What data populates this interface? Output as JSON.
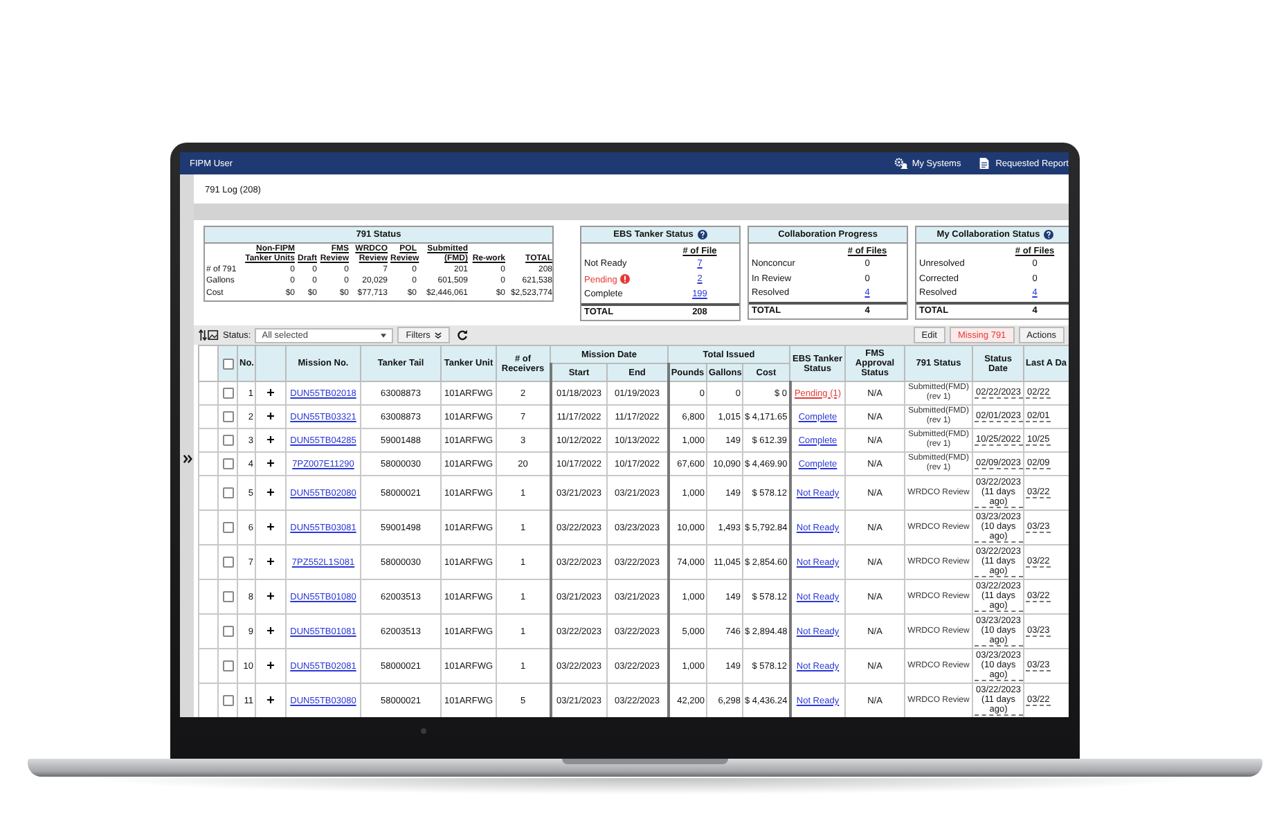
{
  "window": {
    "user": "FIPM User",
    "nav": [
      {
        "label": "My Systems",
        "kind": "systems"
      },
      {
        "label": "Requested Report",
        "kind": "report"
      }
    ]
  },
  "log_title": "791 Log (208)",
  "status_791": {
    "title": "791 Status",
    "columns": [
      "Non-FIPM Tanker Units",
      "Draft",
      "FMS Review",
      "WRDCO Review",
      "POL Review",
      "Submitted (FMD)",
      "Re-work",
      "TOTAL"
    ],
    "rows": [
      {
        "label": "# of 791",
        "values": [
          "0",
          "0",
          "0",
          "7",
          "0",
          "201",
          "0",
          "208"
        ]
      },
      {
        "label": "Gallons",
        "values": [
          "0",
          "0",
          "0",
          "20,029",
          "0",
          "601,509",
          "0",
          "621,538"
        ]
      },
      {
        "label": "Cost",
        "values": [
          "$0",
          "$0",
          "$0",
          "$77,713",
          "$0",
          "$2,446,061",
          "$0",
          "$2,523,774"
        ]
      }
    ]
  },
  "summaries": [
    {
      "title": "EBS Tanker Status",
      "help": true,
      "column": "# of File",
      "rows": [
        {
          "label": "Not Ready",
          "value": "7",
          "alert": false,
          "link": true
        },
        {
          "label": "Pending",
          "value": "2",
          "alert": true,
          "link": true
        },
        {
          "label": "Complete",
          "value": "199",
          "alert": false,
          "link": true
        }
      ],
      "total": {
        "label": "TOTAL",
        "value": "208"
      }
    },
    {
      "title": "Collaboration Progress",
      "help": false,
      "column": "# of Files",
      "rows": [
        {
          "label": "Nonconcur",
          "value": "0",
          "alert": false,
          "link": false
        },
        {
          "label": "In Review",
          "value": "0",
          "alert": false,
          "link": false
        },
        {
          "label": "Resolved",
          "value": "4",
          "alert": false,
          "link": true
        }
      ],
      "total": {
        "label": "TOTAL",
        "value": "4"
      }
    },
    {
      "title": "My Collaboration Status",
      "help": true,
      "column": "# of Files",
      "rows": [
        {
          "label": "Unresolved",
          "value": "0",
          "alert": false,
          "link": false
        },
        {
          "label": "Corrected",
          "value": "0",
          "alert": false,
          "link": false
        },
        {
          "label": "Resolved",
          "value": "4",
          "alert": false,
          "link": true
        }
      ],
      "total": {
        "label": "TOTAL",
        "value": "4"
      }
    }
  ],
  "toolbar": {
    "status_label": "Status:",
    "status_value": "All selected",
    "filters": "Filters",
    "buttons": [
      {
        "label": "Edit",
        "kind": "normal"
      },
      {
        "label": "Missing 791",
        "kind": "warning"
      },
      {
        "label": "Actions",
        "kind": "normal"
      }
    ]
  },
  "table": {
    "header_checked": false,
    "number_label": "No.",
    "columns": [
      {
        "label": "Mission No."
      },
      {
        "label": "Tanker Tail"
      },
      {
        "label": "Tanker Unit"
      },
      {
        "label": "# of Receivers"
      },
      {
        "label": "Mission Date",
        "children": [
          {
            "label": "Start"
          },
          {
            "label": "End"
          }
        ]
      },
      {
        "label": "Total Issued",
        "children": [
          {
            "label": "Pounds"
          },
          {
            "label": "Gallons"
          },
          {
            "label": "Cost"
          }
        ]
      },
      {
        "label": "EBS Tanker Status"
      },
      {
        "label": "FMS Approval Status"
      },
      {
        "label": "791 Status"
      },
      {
        "label": "Status Date"
      },
      {
        "label": "Last A Da"
      }
    ],
    "rows": [
      {
        "checked": false,
        "no": "1",
        "mission": "DUN55TB02018",
        "tail": "63008873",
        "unit": "101ARFWG",
        "receivers": "2",
        "start": "01/18/2023",
        "end": "01/19/2023",
        "pounds": "0",
        "gallons": "0",
        "cost": "$ 0",
        "ebs": {
          "text": "Pending (1)",
          "kind": "pending"
        },
        "fms": "N/A",
        "status": "Submitted(FMD) (rev 1)",
        "status_date": "02/22/2023",
        "last": "02/22"
      },
      {
        "checked": false,
        "no": "2",
        "mission": "DUN55TB03321",
        "tail": "63008873",
        "unit": "101ARFWG",
        "receivers": "7",
        "start": "11/17/2022",
        "end": "11/17/2022",
        "pounds": "6,800",
        "gallons": "1,015",
        "cost": "$ 4,171.65",
        "ebs": {
          "text": "Complete",
          "kind": "link"
        },
        "fms": "N/A",
        "status": "Submitted(FMD) (rev 1)",
        "status_date": "02/01/2023",
        "last": "02/01"
      },
      {
        "checked": false,
        "no": "3",
        "mission": "DUN55TB04285",
        "tail": "59001488",
        "unit": "101ARFWG",
        "receivers": "3",
        "start": "10/12/2022",
        "end": "10/13/2022",
        "pounds": "1,000",
        "gallons": "149",
        "cost": "$ 612.39",
        "ebs": {
          "text": "Complete",
          "kind": "link"
        },
        "fms": "N/A",
        "status": "Submitted(FMD) (rev 1)",
        "status_date": "10/25/2022",
        "last": "10/25"
      },
      {
        "checked": false,
        "no": "4",
        "mission": "7PZ007E11290",
        "tail": "58000030",
        "unit": "101ARFWG",
        "receivers": "20",
        "start": "10/17/2022",
        "end": "10/17/2022",
        "pounds": "67,600",
        "gallons": "10,090",
        "cost": "$ 4,469.90",
        "ebs": {
          "text": "Complete",
          "kind": "link"
        },
        "fms": "N/A",
        "status": "Submitted(FMD) (rev 1)",
        "status_date": "02/09/2023",
        "last": "02/09"
      },
      {
        "checked": false,
        "no": "5",
        "mission": "DUN55TB02080",
        "tail": "58000021",
        "unit": "101ARFWG",
        "receivers": "1",
        "start": "03/21/2023",
        "end": "03/21/2023",
        "pounds": "1,000",
        "gallons": "149",
        "cost": "$ 578.12",
        "ebs": {
          "text": "Not Ready",
          "kind": "link"
        },
        "fms": "N/A",
        "status": "WRDCO Review",
        "status_date": "03/22/2023 (11 days ago)",
        "last": "03/22"
      },
      {
        "checked": false,
        "no": "6",
        "mission": "DUN55TB03081",
        "tail": "59001498",
        "unit": "101ARFWG",
        "receivers": "1",
        "start": "03/22/2023",
        "end": "03/23/2023",
        "pounds": "10,000",
        "gallons": "1,493",
        "cost": "$ 5,792.84",
        "ebs": {
          "text": "Not Ready",
          "kind": "link"
        },
        "fms": "N/A",
        "status": "WRDCO Review",
        "status_date": "03/23/2023 (10 days ago)",
        "last": "03/23"
      },
      {
        "checked": false,
        "no": "7",
        "mission": "7PZ552L1S081",
        "tail": "58000030",
        "unit": "101ARFWG",
        "receivers": "1",
        "start": "03/22/2023",
        "end": "03/22/2023",
        "pounds": "74,000",
        "gallons": "11,045",
        "cost": "$ 2,854.60",
        "ebs": {
          "text": "Not Ready",
          "kind": "link"
        },
        "fms": "N/A",
        "status": "WRDCO Review",
        "status_date": "03/22/2023 (11 days ago)",
        "last": "03/22"
      },
      {
        "checked": false,
        "no": "8",
        "mission": "DUN55TB01080",
        "tail": "62003513",
        "unit": "101ARFWG",
        "receivers": "1",
        "start": "03/21/2023",
        "end": "03/21/2023",
        "pounds": "1,000",
        "gallons": "149",
        "cost": "$ 578.12",
        "ebs": {
          "text": "Not Ready",
          "kind": "link"
        },
        "fms": "N/A",
        "status": "WRDCO Review",
        "status_date": "03/22/2023 (11 days ago)",
        "last": "03/22"
      },
      {
        "checked": false,
        "no": "9",
        "mission": "DUN55TB01081",
        "tail": "62003513",
        "unit": "101ARFWG",
        "receivers": "1",
        "start": "03/22/2023",
        "end": "03/22/2023",
        "pounds": "5,000",
        "gallons": "746",
        "cost": "$ 2,894.48",
        "ebs": {
          "text": "Not Ready",
          "kind": "link"
        },
        "fms": "N/A",
        "status": "WRDCO Review",
        "status_date": "03/23/2023 (10 days ago)",
        "last": "03/23"
      },
      {
        "checked": false,
        "no": "10",
        "mission": "DUN55TB02081",
        "tail": "58000021",
        "unit": "101ARFWG",
        "receivers": "1",
        "start": "03/22/2023",
        "end": "03/22/2023",
        "pounds": "1,000",
        "gallons": "149",
        "cost": "$ 578.12",
        "ebs": {
          "text": "Not Ready",
          "kind": "link"
        },
        "fms": "N/A",
        "status": "WRDCO Review",
        "status_date": "03/23/2023 (10 days ago)",
        "last": "03/23"
      },
      {
        "checked": false,
        "no": "11",
        "mission": "DUN55TB03080",
        "tail": "58000021",
        "unit": "101ARFWG",
        "receivers": "5",
        "start": "03/21/2023",
        "end": "03/22/2023",
        "pounds": "42,200",
        "gallons": "6,298",
        "cost": "$ 4,436.24",
        "ebs": {
          "text": "Not Ready",
          "kind": "link"
        },
        "fms": "N/A",
        "status": "WRDCO Review",
        "status_date": "03/22/2023 (11 days ago)",
        "last": "03/22"
      }
    ]
  }
}
